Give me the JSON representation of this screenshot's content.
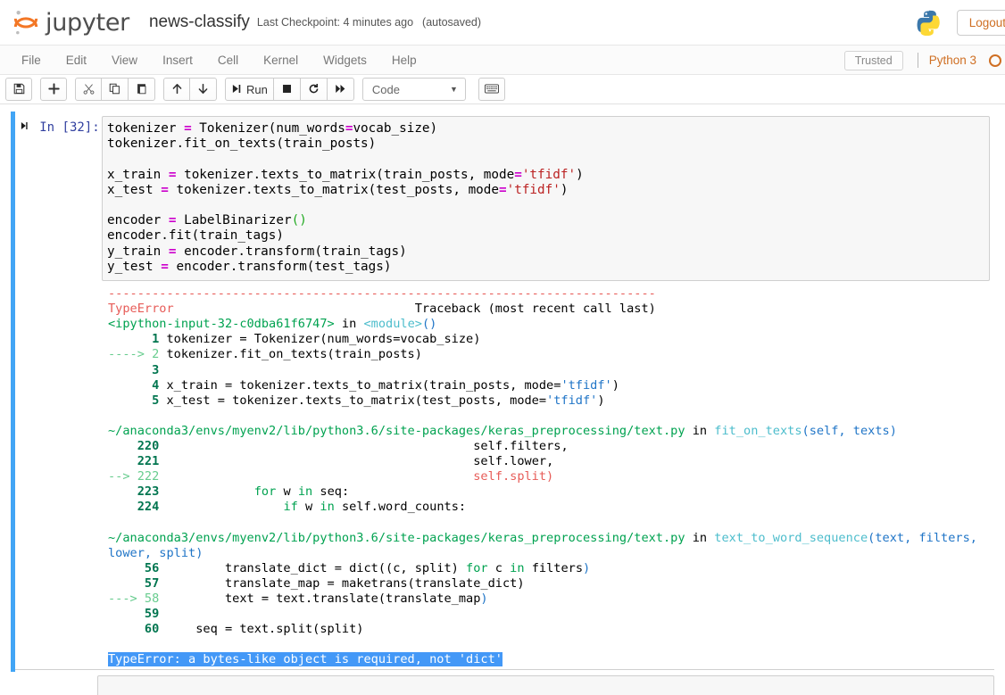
{
  "header": {
    "brand": "jupyter",
    "brand_icon": "jupyter-logo-icon",
    "notebook_name": "news-classify",
    "checkpoint": "Last Checkpoint: 4 minutes ago",
    "autosaved": "(autosaved)",
    "python_logo_icon": "python-logo-icon",
    "logout_label": "Logout"
  },
  "menubar": {
    "items": [
      {
        "label": "File"
      },
      {
        "label": "Edit"
      },
      {
        "label": "View"
      },
      {
        "label": "Insert"
      },
      {
        "label": "Cell"
      },
      {
        "label": "Kernel"
      },
      {
        "label": "Widgets"
      },
      {
        "label": "Help"
      }
    ],
    "trusted_label": "Trusted",
    "kernel_name": "Python 3",
    "kernel_status_icon": "kernel-idle-circle-icon"
  },
  "toolbar": {
    "save_icon": "save-floppy-icon",
    "insert_icon": "plus-add-cell-icon",
    "cut_icon": "scissors-cut-icon",
    "copy_icon": "copy-icon",
    "paste_icon": "paste-icon",
    "move_up_icon": "arrow-up-icon",
    "move_down_icon": "arrow-down-icon",
    "run_label": "Run",
    "run_icon": "run-step-icon",
    "stop_icon": "stop-square-icon",
    "restart_icon": "restart-circle-arrow-icon",
    "restart_run_all_icon": "fast-forward-icon",
    "cell_type_value": "Code",
    "cell_type_caret_icon": "chevron-down-icon",
    "command_palette_icon": "keyboard-icon"
  },
  "cell": {
    "prompt": "In [32]:",
    "run_mark_icon": "play-bar-icon",
    "accent_color": "#42a5f5",
    "code_lines": [
      "tokenizer = Tokenizer(num_words=vocab_size)",
      "tokenizer.fit_on_texts(train_posts)",
      "",
      "x_train = tokenizer.texts_to_matrix(train_posts, mode='tfidf')",
      "x_test = tokenizer.texts_to_matrix(test_posts, mode='tfidf')",
      "",
      "encoder = LabelBinarizer()",
      "encoder.fit(train_tags)",
      "y_train = encoder.transform(train_tags)",
      "y_test = encoder.transform(test_tags)"
    ]
  },
  "output": {
    "separator": "---------------------------------------------------------------------------",
    "exception_type": "TypeError",
    "traceback_header": "Traceback (most recent call last)",
    "frames": [
      {
        "location": "<ipython-input-32-c0dba61f6747>",
        "in_keyword": "in",
        "function": "<module>()",
        "lines": [
          {
            "arrow": "",
            "number": "1",
            "code": "tokenizer = Tokenizer(num_words=vocab_size)"
          },
          {
            "arrow": "----> ",
            "number": "2",
            "code": "tokenizer.fit_on_texts(train_posts)"
          },
          {
            "arrow": "",
            "number": "3",
            "code": ""
          },
          {
            "arrow": "",
            "number": "4",
            "code": "x_train = tokenizer.texts_to_matrix(train_posts, mode='tfidf')"
          },
          {
            "arrow": "",
            "number": "5",
            "code": "x_test = tokenizer.texts_to_matrix(test_posts, mode='tfidf')"
          }
        ]
      },
      {
        "location": "~/anaconda3/envs/myenv2/lib/python3.6/site-packages/keras_preprocessing/text.py",
        "in_keyword": "in",
        "function": "fit_on_texts",
        "args": "(self, texts)",
        "lines": [
          {
            "arrow": "",
            "number": "220",
            "code": "                                          self.filters,"
          },
          {
            "arrow": "",
            "number": "221",
            "code": "                                          self.lower,"
          },
          {
            "arrow": "--> ",
            "number": "222",
            "code": "                                          self.split)",
            "code_error": true
          },
          {
            "arrow": "",
            "number": "223",
            "code": "            for w in seq:"
          },
          {
            "arrow": "",
            "number": "224",
            "code": "                if w in self.word_counts:"
          }
        ]
      },
      {
        "location": "~/anaconda3/envs/myenv2/lib/python3.6/site-packages/keras_preprocessing/text.py",
        "in_keyword": "in",
        "function": "text_to_word_sequence",
        "args": "(text, filters, lower, split)",
        "lines": [
          {
            "arrow": "",
            "number": "56",
            "code": "        translate_dict = dict((c, split) for c in filters)"
          },
          {
            "arrow": "",
            "number": "57",
            "code": "        translate_map = maketrans(translate_dict)"
          },
          {
            "arrow": "---> ",
            "number": "58",
            "code": "        text = text.translate(translate_map)"
          },
          {
            "arrow": "",
            "number": "59",
            "code": ""
          },
          {
            "arrow": "",
            "number": "60",
            "code": "    seq = text.split(split)"
          }
        ]
      }
    ],
    "error_message": "TypeError: a bytes-like object is required, not 'dict'",
    "error_highlight_color": "#4398f7"
  }
}
